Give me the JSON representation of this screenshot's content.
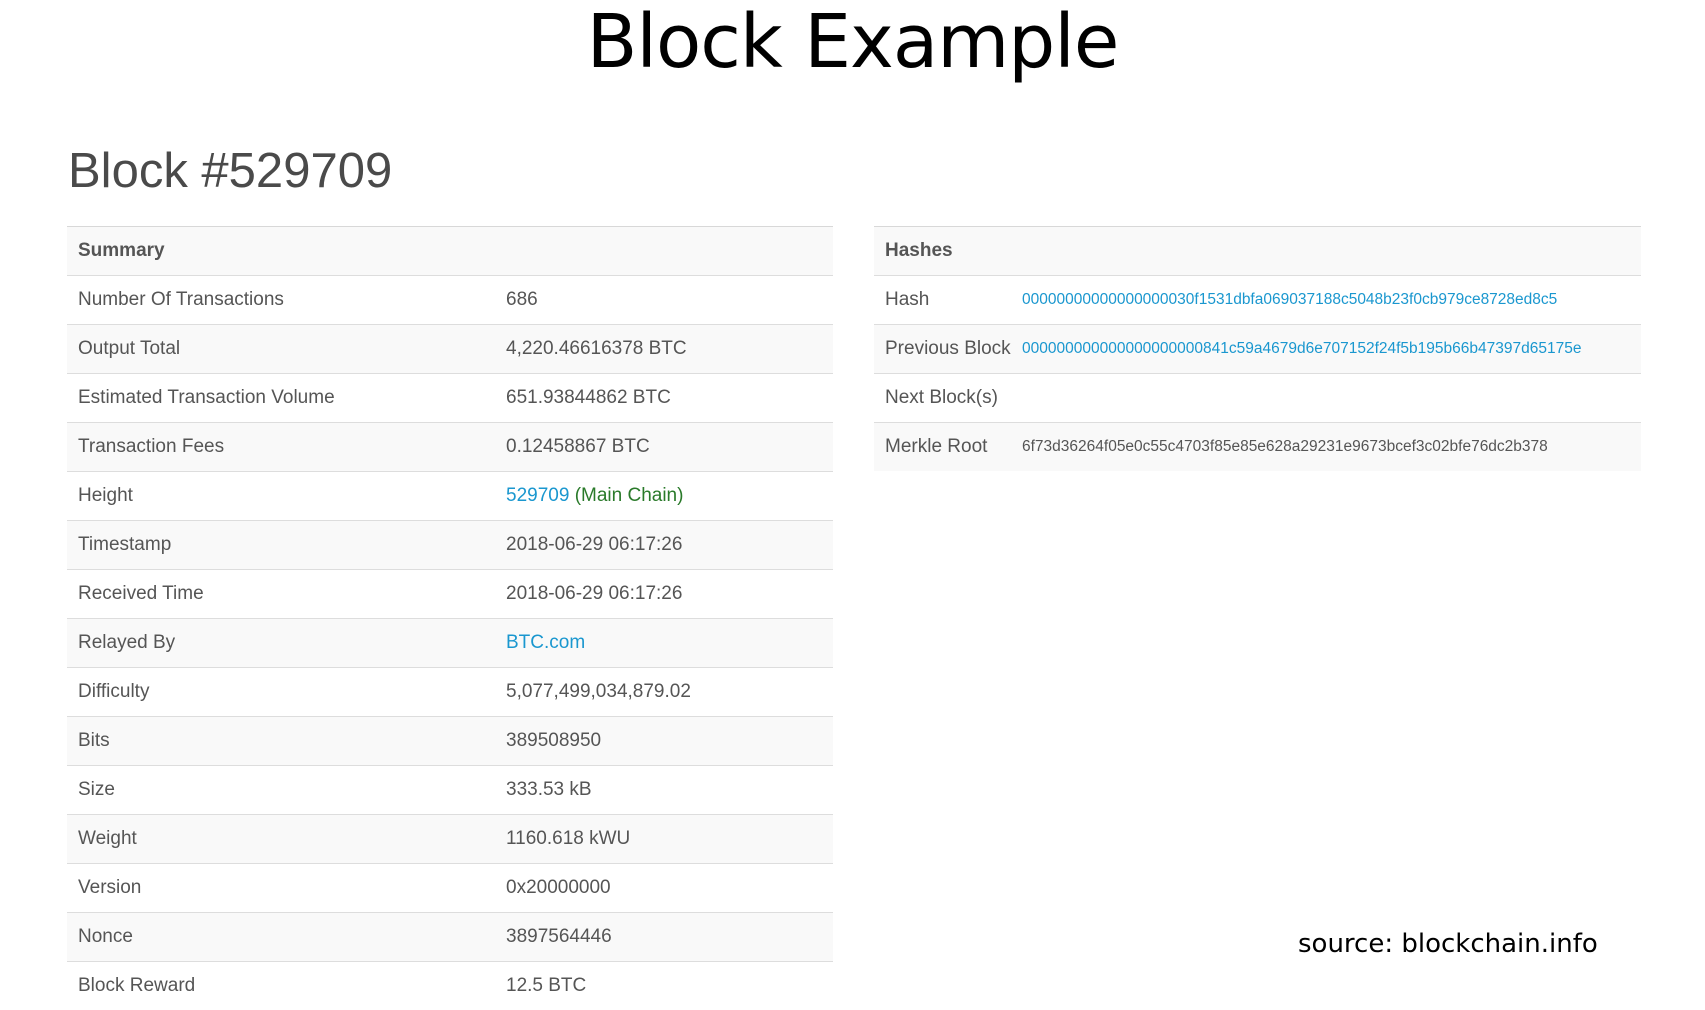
{
  "slide": {
    "title": "Block Example",
    "source": "source: blockchain.info"
  },
  "block": {
    "heading": "Block #529709"
  },
  "summary": {
    "header": "Summary",
    "rows": [
      {
        "label": "Number Of Transactions",
        "value": "686"
      },
      {
        "label": "Output Total",
        "value": "4,220.46616378 BTC"
      },
      {
        "label": "Estimated Transaction Volume",
        "value": "651.93844862 BTC"
      },
      {
        "label": "Transaction Fees",
        "value": "0.12458867 BTC"
      },
      {
        "label": "Height",
        "value": "529709",
        "suffix": "(Main Chain)"
      },
      {
        "label": "Timestamp",
        "value": "2018-06-29 06:17:26"
      },
      {
        "label": "Received Time",
        "value": "2018-06-29 06:17:26"
      },
      {
        "label": "Relayed By",
        "value": "BTC.com"
      },
      {
        "label": "Difficulty",
        "value": "5,077,499,034,879.02"
      },
      {
        "label": "Bits",
        "value": "389508950"
      },
      {
        "label": "Size",
        "value": "333.53 kB"
      },
      {
        "label": "Weight",
        "value": "1160.618 kWU"
      },
      {
        "label": "Version",
        "value": "0x20000000"
      },
      {
        "label": "Nonce",
        "value": "3897564446"
      },
      {
        "label": "Block Reward",
        "value": "12.5 BTC"
      }
    ]
  },
  "hashes": {
    "header": "Hashes",
    "rows": [
      {
        "label": "Hash",
        "value": "00000000000000000030f1531dbfa069037188c5048b23f0cb979ce8728ed8c5"
      },
      {
        "label": "Previous Block",
        "value": "000000000000000000000841c59a4679d6e707152f24f5b195b66b47397d65175e"
      },
      {
        "label": "Next Block(s)",
        "value": ""
      },
      {
        "label": "Merkle Root",
        "value": "6f73d36264f05e0c55c4703f85e85e628a29231e9673bcef3c02bfe76dc2b378"
      }
    ]
  },
  "colors": {
    "link": "#1a97cf",
    "main_chain": "#2a7a2a",
    "text": "#555555",
    "stripe": "#f9f9f9",
    "border": "#dddddd"
  }
}
